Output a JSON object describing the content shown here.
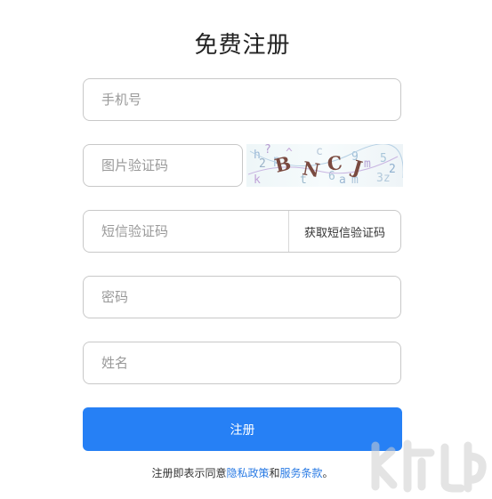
{
  "page": {
    "title": "免费注册"
  },
  "form": {
    "phone": {
      "placeholder": "手机号",
      "value": ""
    },
    "captcha": {
      "placeholder": "图片验证码",
      "value": ""
    },
    "captcha_image_text": "BNCJ",
    "sms_code": {
      "placeholder": "短信验证码",
      "value": ""
    },
    "get_sms_label": "获取短信验证码",
    "password": {
      "placeholder": "密码",
      "value": ""
    },
    "name": {
      "placeholder": "姓名",
      "value": ""
    },
    "submit_label": "注册"
  },
  "agreement": {
    "prefix": "注册即表示同意",
    "privacy_link": "隐私政策",
    "conjunction": "和",
    "terms_link": "服务条款",
    "suffix": "。"
  },
  "watermark": {
    "text": "下载吧"
  },
  "colors": {
    "primary": "#2680f5",
    "link": "#2a7be4",
    "border": "#c8c8c8"
  }
}
